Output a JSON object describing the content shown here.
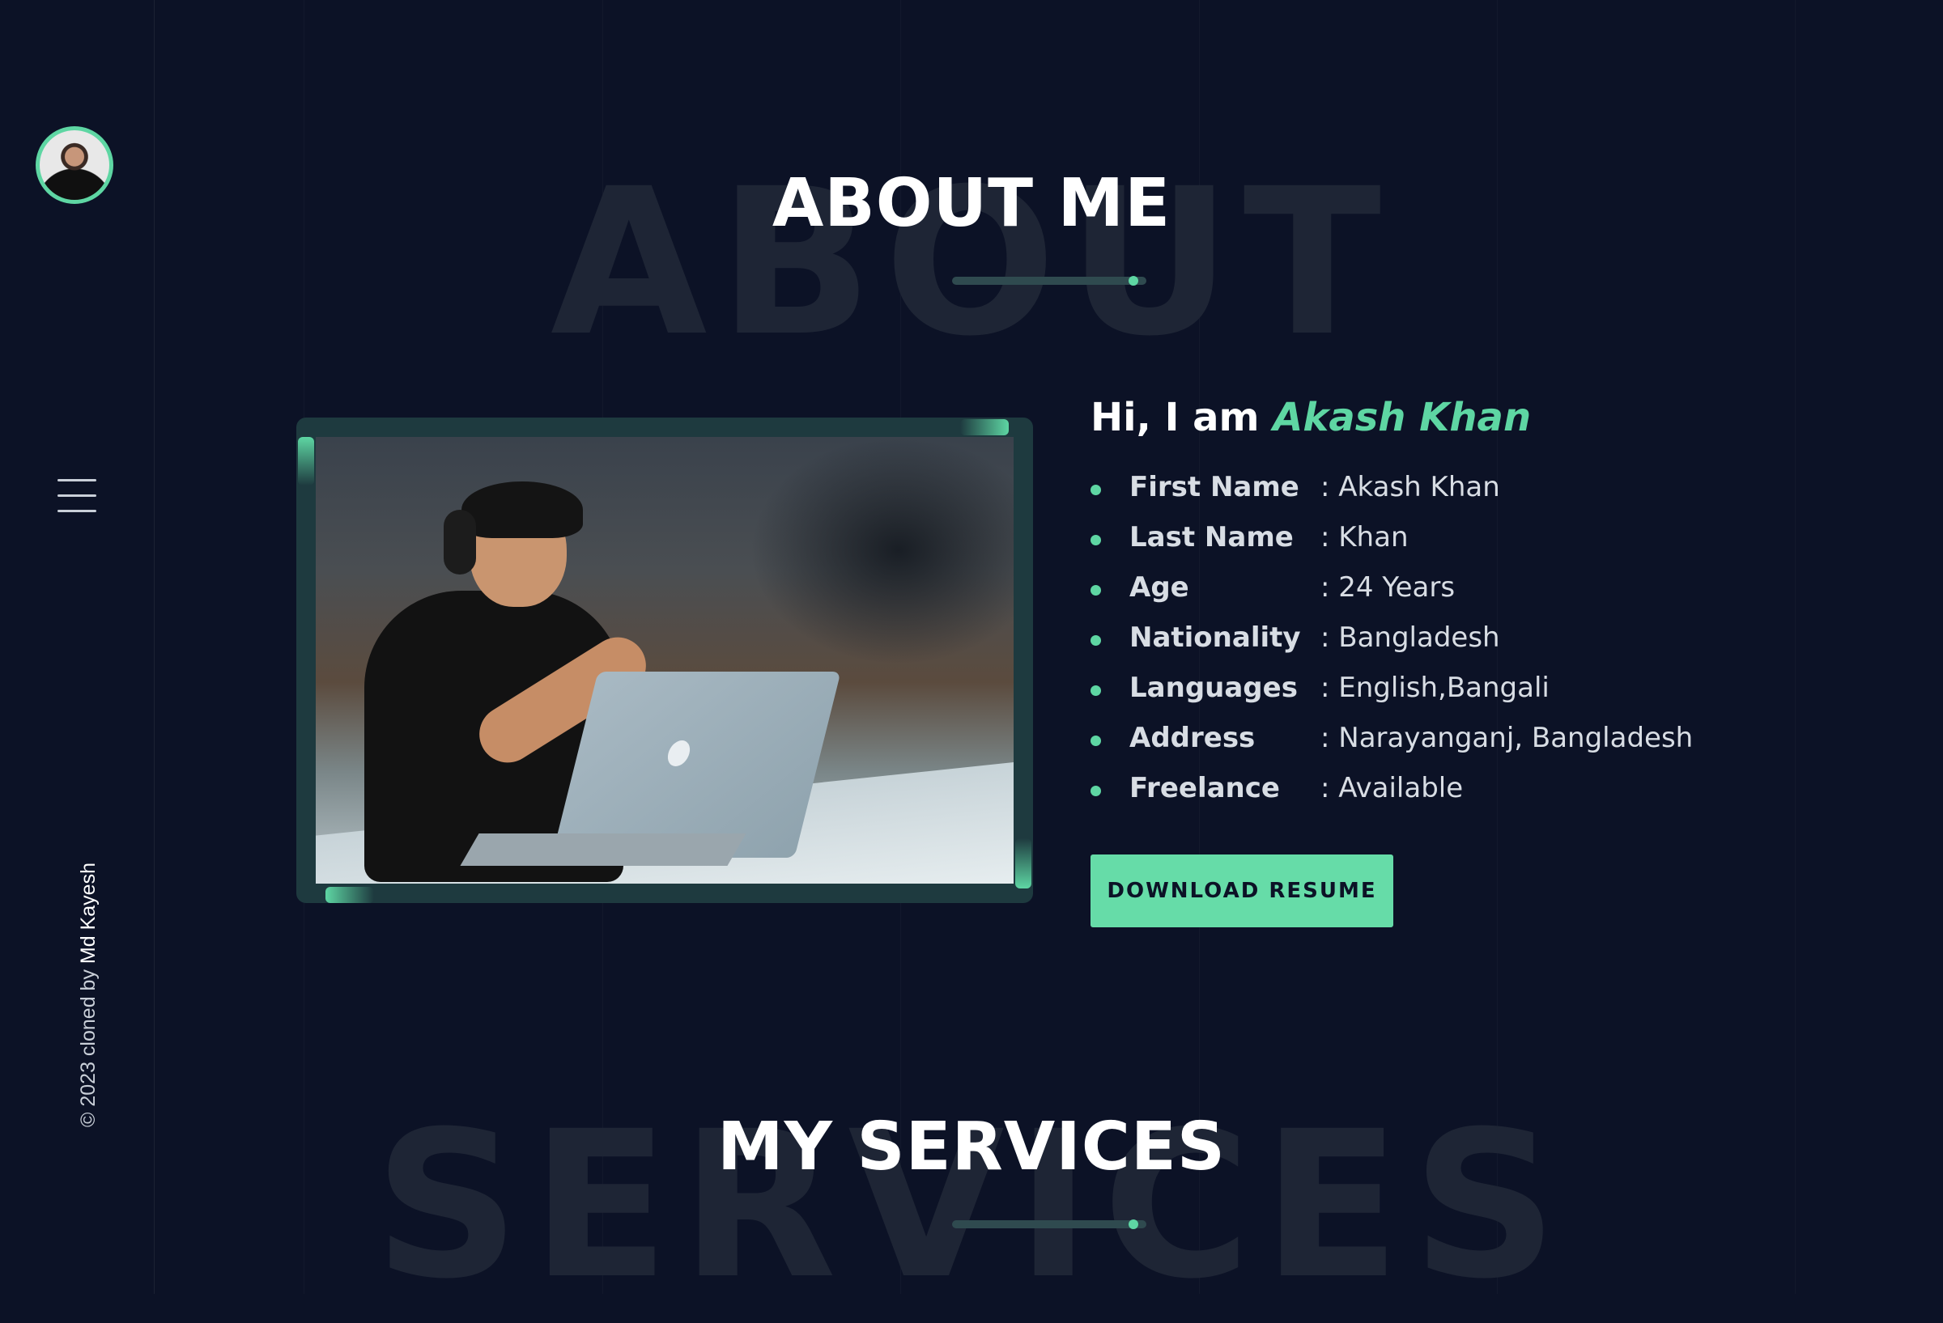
{
  "sidebar": {
    "credit_prefix": "© 2023 cloned by ",
    "credit_author": "Md Kayesh"
  },
  "about": {
    "bg_word": "ABOUT",
    "title": "ABOUT ME",
    "greeting_prefix": "Hi, I am ",
    "greeting_name": "Akash Khan",
    "info": [
      {
        "label": "First Name",
        "value": ": Akash Khan"
      },
      {
        "label": "Last Name",
        "value": ": Khan"
      },
      {
        "label": "Age",
        "value": ": 24 Years"
      },
      {
        "label": "Nationality",
        "value": ": Bangladesh"
      },
      {
        "label": "Languages",
        "value": ": English,Bangali"
      },
      {
        "label": "Address",
        "value": ": Narayanganj, Bangladesh"
      },
      {
        "label": "Freelance",
        "value": ": Available"
      }
    ],
    "button_label": "DOWNLOAD RESUME"
  },
  "services": {
    "bg_word": "SERVICES",
    "title": "MY SERVICES"
  },
  "colors": {
    "background": "#0c1226",
    "accent": "#5ed6a3",
    "frame": "#1e3a3f"
  }
}
